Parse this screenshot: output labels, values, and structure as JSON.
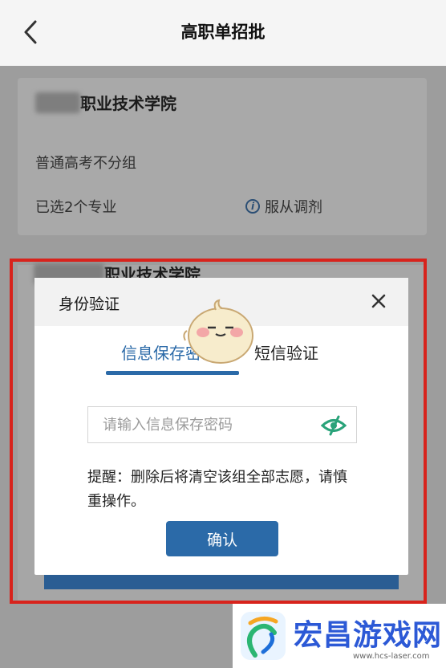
{
  "navbar": {
    "title": "高职单招批"
  },
  "card1": {
    "school_suffix": "职业技术学院",
    "group": "普通高考不分组",
    "selected": "已选2个专业",
    "obey": "服从调剂"
  },
  "card2": {
    "school_suffix": "职业技术学院"
  },
  "modal": {
    "title": "身份验证",
    "tabs": [
      {
        "label": "信息保存密码",
        "active": true
      },
      {
        "label": "短信验证",
        "active": false
      }
    ],
    "password_placeholder": "请输入信息保存密码",
    "warning": "提醒：删除后将清空该组全部志愿，请慎重操作。",
    "confirm_label": "确认"
  },
  "watermark": {
    "name": "宏昌游戏网",
    "url": "www.hcs-laser.com"
  },
  "colors": {
    "accent": "#2b6aa8",
    "highlight_border": "#d8231c",
    "eye_icon": "#2aa37a"
  }
}
